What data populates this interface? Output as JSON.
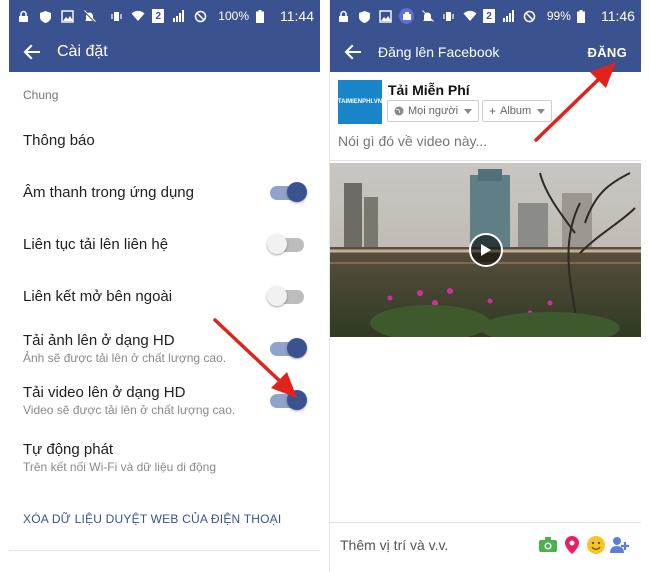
{
  "colors": {
    "brand": "#3b5290",
    "toggle_on": "#3b5290",
    "toggle_on_track": "#8fa3cc",
    "toggle_off_track": "#bdbdbd",
    "arrow": "#e0241b"
  },
  "left_phone": {
    "statusbar": {
      "battery_text": "100%",
      "time": "11:44",
      "sim_badge": "2"
    },
    "appbar": {
      "title": "Cài đặt"
    },
    "section_header": "Chung",
    "settings": [
      {
        "label": "Thông báo"
      },
      {
        "label": "Âm thanh trong ứng dụng",
        "toggle": "on"
      },
      {
        "label": "Liên tục tải lên liên hệ",
        "toggle": "off"
      },
      {
        "label": "Liên kết mở bên ngoài",
        "toggle": "off"
      },
      {
        "label": "Tải ảnh lên ở dạng HD",
        "sub": "Ảnh sẽ được tải lên ở chất lượng cao.",
        "toggle": "on"
      },
      {
        "label": "Tải video lên ở dạng HD",
        "sub": "Video sẽ được tải lên ở chất lượng cao.",
        "toggle": "on"
      },
      {
        "label": "Tự động phát",
        "sub": "Trên kết nối Wi-Fi và dữ liệu di động"
      }
    ],
    "clear_link": "XÓA DỮ LIỆU DUYỆT WEB CỦA ĐIỆN THOẠI"
  },
  "right_phone": {
    "statusbar": {
      "battery_text": "99%",
      "time": "11:46",
      "sim_badge": "2"
    },
    "appbar": {
      "title": "Đăng lên Facebook",
      "action": "ĐĂNG"
    },
    "avatar_text": "TAIMIENPHI.VN",
    "page_name": "Tải Miễn Phí",
    "audience_chip": "Mọi người",
    "album_chip": "Album",
    "post_placeholder": "Nói gì đó về video này...",
    "footer_text": "Thêm vị trí và v.v."
  }
}
